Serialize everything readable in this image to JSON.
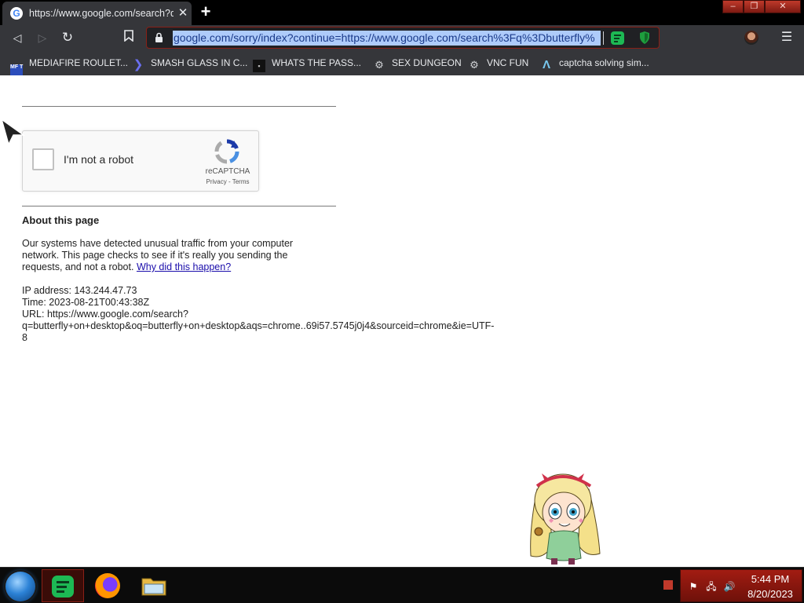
{
  "browser": {
    "tab": {
      "title": "https://www.google.com/search?q=butterfly+on+desktop",
      "favicon": "google-g-icon"
    },
    "address_bar": {
      "url": "google.com/sorry/index?continue=https://www.google.com/search%3Fq%3Dbutterfly%",
      "secure": true
    },
    "bookmarks": [
      {
        "label": "MEDIAFIRE ROULET...",
        "icon": "mediafire-icon",
        "icon_text": "MF T"
      },
      {
        "label": "SMASH GLASS IN C...",
        "icon": "chevron-icon",
        "icon_text": "❯"
      },
      {
        "label": "WHATS THE PASS...",
        "icon": "site-icon",
        "icon_text": "▪"
      },
      {
        "label": "SEX DUNGEON",
        "icon": "gear-icon",
        "icon_text": "⚙"
      },
      {
        "label": "VNC FUN",
        "icon": "gear-icon",
        "icon_text": "⚙"
      },
      {
        "label": "captcha solving sim...",
        "icon": "lambda-icon",
        "icon_text": "Λ"
      }
    ]
  },
  "captcha": {
    "label": "I'm not a robot",
    "brand": "reCAPTCHA",
    "links": "Privacy - Terms",
    "checked": false
  },
  "about": {
    "heading": "About this page",
    "body": "Our systems have detected unusual traffic from your computer network. This page checks to see if it's really you sending the requests, and not a robot.",
    "link": "Why did this happen?"
  },
  "details": {
    "ip": "IP address: 143.244.47.73",
    "time": "Time: 2023-08-21T00:43:38Z",
    "url_line1": "URL: https://www.google.com/search?",
    "url_line2": "q=butterfly+on+desktop&oq=butterfly+on+desktop&aqs=chrome..69i57.5745j0j4&sourceid=chrome&ie=UTF-",
    "url_line3": "8"
  },
  "taskbar": {
    "time": "5:44 PM",
    "date": "8/20/2023",
    "pinned": [
      "spotify-icon",
      "firefox-icon",
      "file-explorer-icon"
    ]
  },
  "colors": {
    "chrome_bg": "#35363a",
    "accent_red": "#a21c12",
    "link_blue": "#1a0dab",
    "url_highlight": "#aecbfa"
  }
}
